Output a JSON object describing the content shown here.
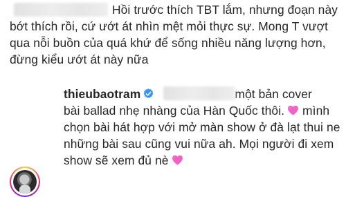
{
  "comment1": {
    "lines": [
      "Hồi trước thích TBT lắm, nhưng đoạn này",
      "bớt thích rồi, cứ ướt át nhìn mệt mỏi thực sự. Mong T vượt",
      "qua nỗi buồn của quá khứ để sống nhiều năng lượng hơn,",
      "đừng kiểu ướt át này nữa"
    ]
  },
  "comment2": {
    "username": "thieubaotram",
    "badge_icon": "verified-badge-icon",
    "lines": [
      "một bản cover",
      "bài ballad nhẹ nhàng của Hàn Quốc thôi.",
      "mình",
      "chọn bài hát hợp với mở màn show ở đà lạt thui ne",
      "những bài sau cũng vui nữa ah. Mọi người đi xem",
      "show sẽ xem đủ nè"
    ],
    "emoji_icon": "pink-heart-icon"
  },
  "colors": {
    "text": "#262626",
    "verified_blue": "#3897f0",
    "heart_pink": "#f062c6"
  }
}
